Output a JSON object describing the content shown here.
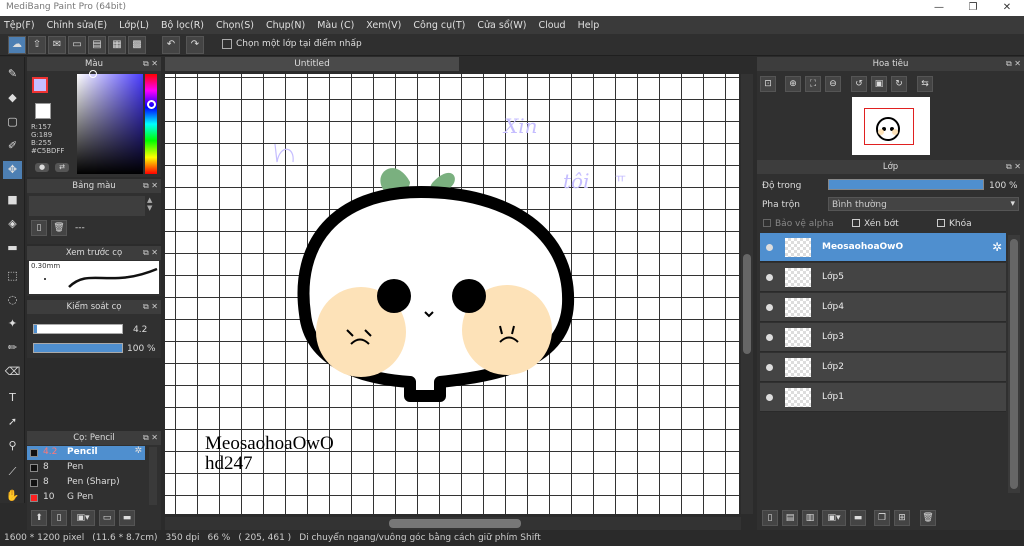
{
  "title": "MediBang Paint Pro (64bit)",
  "menu": [
    "Tệp(F)",
    "Chỉnh sửa(E)",
    "Lớp(L)",
    "Bộ lọc(R)",
    "Chọn(S)",
    "Chụp(N)",
    "Màu (C)",
    "Xem(V)",
    "Công cụ(T)",
    "Cửa sổ(W)",
    "Cloud",
    "Help"
  ],
  "toolbar": {
    "checkbox_label": "Chọn một lớp tại điểm nhấp"
  },
  "color_panel": {
    "title": "Màu",
    "r": "R:157",
    "g": "G:189",
    "b": "B:255",
    "hex": "#C5BDFF",
    "current": "#c5bdff"
  },
  "palette_panel": {
    "title": "Bảng màu",
    "name": "---"
  },
  "brush_preview": {
    "title": "Xem trước cọ",
    "size": "0.30mm"
  },
  "brush_control": {
    "title": "Kiểm soát cọ",
    "size_value": "4.2",
    "opacity_value": "100 %",
    "opacity_fraction": 1.0
  },
  "brush_panel": {
    "title": "Cọ: Pencil",
    "items": [
      {
        "size": "4.2",
        "name": "Pencil",
        "color": "#111111",
        "selected": true
      },
      {
        "size": "8",
        "name": "Pen",
        "color": "#111111",
        "selected": false
      },
      {
        "size": "8",
        "name": "Pen (Sharp)",
        "color": "#111111",
        "selected": false
      },
      {
        "size": "10",
        "name": "G Pen",
        "color": "#ff2020",
        "selected": false
      }
    ]
  },
  "document": {
    "tab": "Untitled",
    "text_line1": "MeosaohoaOwO",
    "text_line2": "hd247",
    "handwriting_1": "Xin",
    "handwriting_2": "tôi",
    "handwriting_3": "ㅠ"
  },
  "navigator": {
    "title": "Hoa tiêu"
  },
  "layer_panel": {
    "title": "Lớp",
    "opacity_label": "Độ trong",
    "opacity_value": "100 %",
    "opacity_fraction": 1.0,
    "blend_label": "Pha trộn",
    "blend_value": "Bình thường",
    "protect_alpha": "Bảo vệ alpha",
    "clipping": "Xén bớt",
    "lock": "Khóa",
    "layers": [
      {
        "name": "MeosaohoaOwO",
        "selected": true
      },
      {
        "name": "Lớp5",
        "selected": false
      },
      {
        "name": "Lớp4",
        "selected": false
      },
      {
        "name": "Lớp3",
        "selected": false
      },
      {
        "name": "Lớp2",
        "selected": false
      },
      {
        "name": "Lớp1",
        "selected": false
      }
    ]
  },
  "status": {
    "size": "1600 * 1200 pixel",
    "cm": "(11.6 * 8.7cm)",
    "dpi": "350 dpi",
    "zoom": "66 %",
    "coords": "( 205, 461 )",
    "hint": "Di chuyển ngang/vuông góc bằng cách giữ phím Shift"
  }
}
